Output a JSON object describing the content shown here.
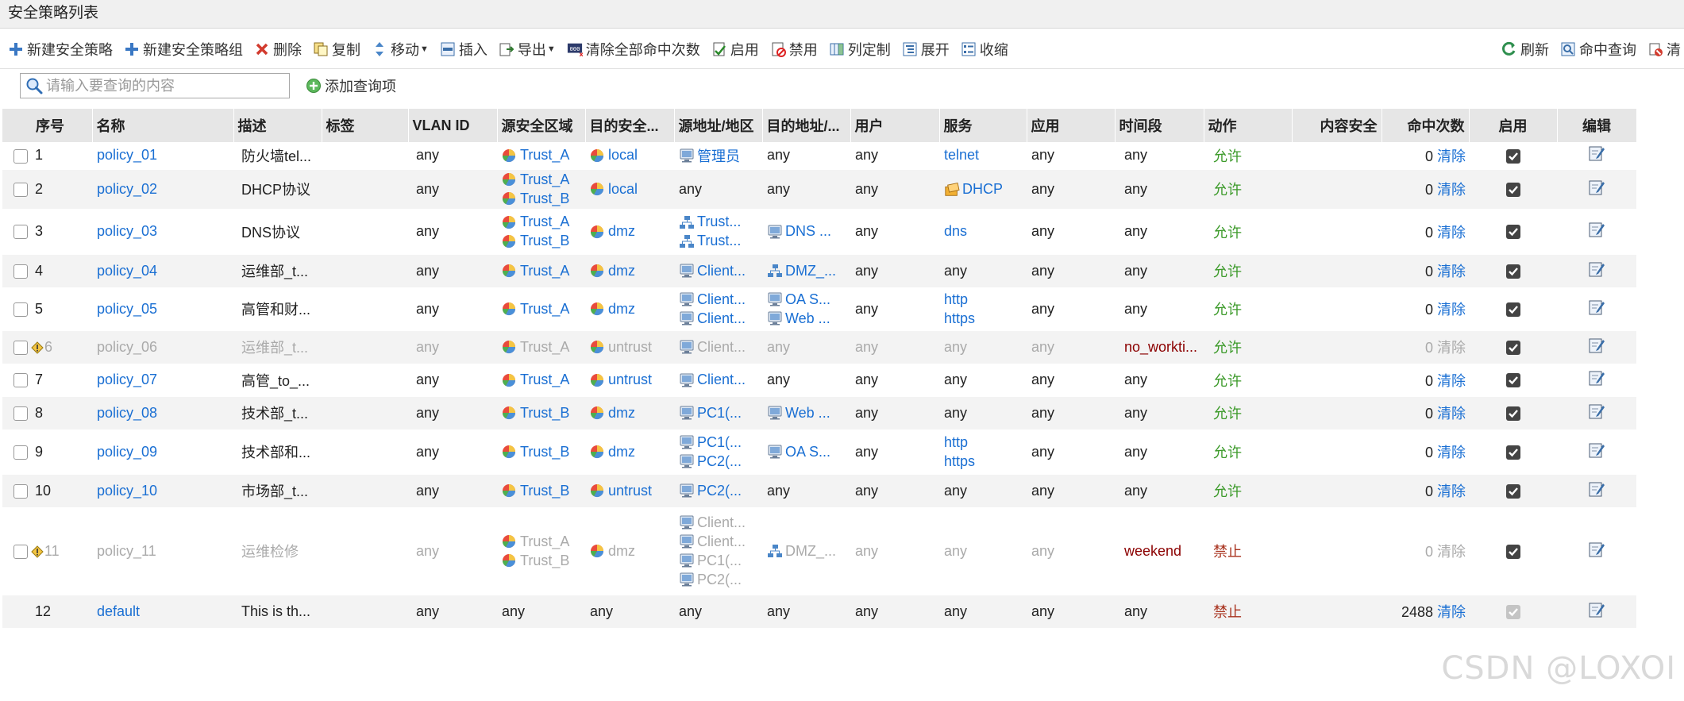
{
  "window": {
    "title": "安全策略列表"
  },
  "toolbar": {
    "left": [
      {
        "label": "新建安全策略",
        "icon": "plus-icon",
        "dropdown": false
      },
      {
        "label": "新建安全策略组",
        "icon": "plus-icon",
        "dropdown": false
      },
      {
        "label": "删除",
        "icon": "delete-icon",
        "dropdown": false
      },
      {
        "label": "复制",
        "icon": "copy-icon",
        "dropdown": false
      },
      {
        "label": "移动",
        "icon": "move-icon",
        "dropdown": true
      },
      {
        "label": "插入",
        "icon": "insert-icon",
        "dropdown": false
      },
      {
        "label": "导出",
        "icon": "export-icon",
        "dropdown": true
      },
      {
        "label": "清除全部命中次数",
        "icon": "clear-hits-icon",
        "dropdown": false
      },
      {
        "label": "启用",
        "icon": "enable-icon",
        "dropdown": false
      },
      {
        "label": "禁用",
        "icon": "disable-icon",
        "dropdown": false
      },
      {
        "label": "列定制",
        "icon": "columns-icon",
        "dropdown": false
      },
      {
        "label": "展开",
        "icon": "expand-icon",
        "dropdown": false
      },
      {
        "label": "收缩",
        "icon": "collapse-icon",
        "dropdown": false
      }
    ],
    "right": [
      {
        "label": "刷新",
        "icon": "refresh-icon"
      },
      {
        "label": "命中查询",
        "icon": "hit-query-icon"
      },
      {
        "label": "清",
        "icon": "clear-icon"
      }
    ]
  },
  "search": {
    "placeholder": "请输入要查询的内容",
    "add_query_label": "添加查询项"
  },
  "columns": [
    "序号",
    "名称",
    "描述",
    "标签",
    "VLAN ID",
    "源安全区域",
    "目的安全...",
    "源地址/地区",
    "目的地址/...",
    "用户",
    "服务",
    "应用",
    "时间段",
    "动作",
    "内容安全",
    "命中次数",
    "启用",
    "编辑"
  ],
  "rows": [
    {
      "id": "1",
      "name": "policy_01",
      "desc": "防火墙tel...",
      "tag": "",
      "vlan": "any",
      "src_zone": [
        {
          "text": "Trust_A",
          "icon": "zone-icon"
        }
      ],
      "dst_zone": [
        {
          "text": "local",
          "icon": "zone-icon"
        }
      ],
      "src_addr": [
        {
          "text": "管理员",
          "icon": "host-icon",
          "link": true
        }
      ],
      "dst_addr": [
        {
          "text": "any"
        }
      ],
      "user": "any",
      "service": [
        {
          "text": "telnet",
          "link": true
        }
      ],
      "app": "any",
      "time": "any",
      "time_red": false,
      "action": "允许",
      "action_type": "allow",
      "hits": "0",
      "clear": "清除",
      "enabled": true,
      "disabled_row": false,
      "warn": false,
      "height": 34
    },
    {
      "id": "2",
      "name": "policy_02",
      "desc": "DHCP协议",
      "tag": "",
      "vlan": "any",
      "src_zone": [
        {
          "text": "Trust_A",
          "icon": "zone-icon"
        },
        {
          "text": "Trust_B",
          "icon": "zone-icon"
        }
      ],
      "dst_zone": [
        {
          "text": "local",
          "icon": "zone-icon"
        }
      ],
      "src_addr": [
        {
          "text": "any"
        }
      ],
      "dst_addr": [
        {
          "text": "any"
        }
      ],
      "user": "any",
      "service": [
        {
          "text": "DHCP",
          "icon": "service-icon",
          "link": true
        }
      ],
      "app": "any",
      "time": "any",
      "time_red": false,
      "action": "允许",
      "action_type": "allow",
      "hits": "0",
      "clear": "清除",
      "enabled": true,
      "disabled_row": false,
      "warn": false,
      "height": 48
    },
    {
      "id": "3",
      "name": "policy_03",
      "desc": "DNS协议",
      "tag": "",
      "vlan": "any",
      "src_zone": [
        {
          "text": "Trust_A",
          "icon": "zone-icon"
        },
        {
          "text": "Trust_B",
          "icon": "zone-icon"
        }
      ],
      "dst_zone": [
        {
          "text": "dmz",
          "icon": "zone-icon"
        }
      ],
      "src_addr": [
        {
          "text": "Trust...",
          "icon": "network-icon",
          "link": true
        },
        {
          "text": "Trust...",
          "icon": "network-icon",
          "link": true
        }
      ],
      "dst_addr": [
        {
          "text": "DNS ...",
          "icon": "host-icon",
          "link": true
        }
      ],
      "user": "any",
      "service": [
        {
          "text": "dns",
          "link": true
        }
      ],
      "app": "any",
      "time": "any",
      "time_red": false,
      "action": "允许",
      "action_type": "allow",
      "hits": "0",
      "clear": "清除",
      "enabled": true,
      "disabled_row": false,
      "warn": false,
      "height": 57
    },
    {
      "id": "4",
      "name": "policy_04",
      "desc": "运维部_t...",
      "tag": "",
      "vlan": "any",
      "src_zone": [
        {
          "text": "Trust_A",
          "icon": "zone-icon"
        }
      ],
      "dst_zone": [
        {
          "text": "dmz",
          "icon": "zone-icon"
        }
      ],
      "src_addr": [
        {
          "text": "Client...",
          "icon": "host-icon",
          "link": true
        }
      ],
      "dst_addr": [
        {
          "text": "DMZ_...",
          "icon": "network-icon",
          "link": true
        }
      ],
      "user": "any",
      "service": [
        {
          "text": "any"
        }
      ],
      "app": "any",
      "time": "any",
      "time_red": false,
      "action": "允许",
      "action_type": "allow",
      "hits": "0",
      "clear": "清除",
      "enabled": true,
      "disabled_row": false,
      "warn": false,
      "height": 42
    },
    {
      "id": "5",
      "name": "policy_05",
      "desc": "高管和财...",
      "tag": "",
      "vlan": "any",
      "src_zone": [
        {
          "text": "Trust_A",
          "icon": "zone-icon"
        }
      ],
      "dst_zone": [
        {
          "text": "dmz",
          "icon": "zone-icon"
        }
      ],
      "src_addr": [
        {
          "text": "Client...",
          "icon": "host-icon",
          "link": true
        },
        {
          "text": "Client...",
          "icon": "host-icon",
          "link": true
        }
      ],
      "dst_addr": [
        {
          "text": "OA S...",
          "icon": "host-icon",
          "link": true
        },
        {
          "text": "Web ...",
          "icon": "host-icon",
          "link": true
        }
      ],
      "user": "any",
      "service": [
        {
          "text": "http",
          "link": true
        },
        {
          "text": "https",
          "link": true
        }
      ],
      "app": "any",
      "time": "any",
      "time_red": false,
      "action": "允许",
      "action_type": "allow",
      "hits": "0",
      "clear": "清除",
      "enabled": true,
      "disabled_row": false,
      "warn": false,
      "height": 54
    },
    {
      "id": "6",
      "name": "policy_06",
      "desc": "运维部_t...",
      "tag": "",
      "vlan": "any",
      "src_zone": [
        {
          "text": "Trust_A",
          "icon": "zone-icon"
        }
      ],
      "dst_zone": [
        {
          "text": "untrust",
          "icon": "zone-icon"
        }
      ],
      "src_addr": [
        {
          "text": "Client...",
          "icon": "host-icon",
          "link": true
        }
      ],
      "dst_addr": [
        {
          "text": "any"
        }
      ],
      "user": "any",
      "service": [
        {
          "text": "any"
        }
      ],
      "app": "any",
      "time": "no_workti...",
      "time_red": true,
      "action": "允许",
      "action_type": "allow",
      "hits": "0",
      "clear": "清除",
      "enabled": true,
      "disabled_row": true,
      "warn": true,
      "height": 42
    },
    {
      "id": "7",
      "name": "policy_07",
      "desc": "高管_to_...",
      "tag": "",
      "vlan": "any",
      "src_zone": [
        {
          "text": "Trust_A",
          "icon": "zone-icon"
        }
      ],
      "dst_zone": [
        {
          "text": "untrust",
          "icon": "zone-icon"
        }
      ],
      "src_addr": [
        {
          "text": "Client...",
          "icon": "host-icon",
          "link": true
        }
      ],
      "dst_addr": [
        {
          "text": "any"
        }
      ],
      "user": "any",
      "service": [
        {
          "text": "any"
        }
      ],
      "app": "any",
      "time": "any",
      "time_red": false,
      "action": "允许",
      "action_type": "allow",
      "hits": "0",
      "clear": "清除",
      "enabled": true,
      "disabled_row": false,
      "warn": false,
      "height": 41
    },
    {
      "id": "8",
      "name": "policy_08",
      "desc": "技术部_t...",
      "tag": "",
      "vlan": "any",
      "src_zone": [
        {
          "text": "Trust_B",
          "icon": "zone-icon"
        }
      ],
      "dst_zone": [
        {
          "text": "dmz",
          "icon": "zone-icon"
        }
      ],
      "src_addr": [
        {
          "text": "PC1(...",
          "icon": "host-icon",
          "link": true
        }
      ],
      "dst_addr": [
        {
          "text": "Web ...",
          "icon": "host-icon",
          "link": true
        }
      ],
      "user": "any",
      "service": [
        {
          "text": "any"
        }
      ],
      "app": "any",
      "time": "any",
      "time_red": false,
      "action": "允许",
      "action_type": "allow",
      "hits": "0",
      "clear": "清除",
      "enabled": true,
      "disabled_row": false,
      "warn": false,
      "height": 42
    },
    {
      "id": "9",
      "name": "policy_09",
      "desc": "技术部和...",
      "tag": "",
      "vlan": "any",
      "src_zone": [
        {
          "text": "Trust_B",
          "icon": "zone-icon"
        }
      ],
      "dst_zone": [
        {
          "text": "dmz",
          "icon": "zone-icon"
        }
      ],
      "src_addr": [
        {
          "text": "PC1(...",
          "icon": "host-icon",
          "link": true
        },
        {
          "text": "PC2(...",
          "icon": "host-icon",
          "link": true
        }
      ],
      "dst_addr": [
        {
          "text": "OA S...",
          "icon": "host-icon",
          "link": true
        }
      ],
      "user": "any",
      "service": [
        {
          "text": "http",
          "link": true
        },
        {
          "text": "https",
          "link": true
        }
      ],
      "app": "any",
      "time": "any",
      "time_red": false,
      "action": "允许",
      "action_type": "allow",
      "hits": "0",
      "clear": "清除",
      "enabled": true,
      "disabled_row": false,
      "warn": false,
      "height": 56
    },
    {
      "id": "10",
      "name": "policy_10",
      "desc": "市场部_t...",
      "tag": "",
      "vlan": "any",
      "src_zone": [
        {
          "text": "Trust_B",
          "icon": "zone-icon"
        }
      ],
      "dst_zone": [
        {
          "text": "untrust",
          "icon": "zone-icon"
        }
      ],
      "src_addr": [
        {
          "text": "PC2(...",
          "icon": "host-icon",
          "link": true
        }
      ],
      "dst_addr": [
        {
          "text": "any"
        }
      ],
      "user": "any",
      "service": [
        {
          "text": "any"
        }
      ],
      "app": "any",
      "time": "any",
      "time_red": false,
      "action": "允许",
      "action_type": "allow",
      "hits": "0",
      "clear": "清除",
      "enabled": true,
      "disabled_row": false,
      "warn": false,
      "height": 42
    },
    {
      "id": "11",
      "name": "policy_11",
      "desc": "运维检修",
      "tag": "",
      "vlan": "any",
      "src_zone": [
        {
          "text": "Trust_A",
          "icon": "zone-icon"
        },
        {
          "text": "Trust_B",
          "icon": "zone-icon"
        }
      ],
      "dst_zone": [
        {
          "text": "dmz",
          "icon": "zone-icon"
        }
      ],
      "src_addr": [
        {
          "text": "Client...",
          "icon": "host-icon",
          "link": true
        },
        {
          "text": "Client...",
          "icon": "host-icon",
          "link": true
        },
        {
          "text": "PC1(...",
          "icon": "host-icon",
          "link": true
        },
        {
          "text": "PC2(...",
          "icon": "host-icon",
          "link": true
        }
      ],
      "dst_addr": [
        {
          "text": "DMZ_...",
          "icon": "network-icon",
          "link": true
        }
      ],
      "user": "any",
      "service": [
        {
          "text": "any"
        }
      ],
      "app": "any",
      "time": "weekend",
      "time_red": true,
      "action": "禁止",
      "action_type": "deny",
      "hits": "0",
      "clear": "清除",
      "enabled": true,
      "disabled_row": true,
      "warn": true,
      "height": 110
    },
    {
      "id": "12",
      "name": "default",
      "desc": "This is th...",
      "tag": "",
      "vlan": "any",
      "src_zone": [
        {
          "text": "any"
        }
      ],
      "dst_zone": [
        {
          "text": "any"
        }
      ],
      "src_addr": [
        {
          "text": "any"
        }
      ],
      "dst_addr": [
        {
          "text": "any"
        }
      ],
      "user": "any",
      "service": [
        {
          "text": "any"
        }
      ],
      "app": "any",
      "time": "any",
      "time_red": false,
      "action": "禁止",
      "action_type": "deny",
      "hits": "2488",
      "clear": "清除",
      "enabled": true,
      "enabled_grey": true,
      "no_checkbox": true,
      "disabled_row": false,
      "warn": false,
      "height": 42
    }
  ],
  "watermark": "CSDN @LOXOI",
  "colors": {
    "link": "#1a6fd3",
    "allow": "#3c9a2a",
    "deny": "#a8321e",
    "header_bg": "#e6e6e6",
    "stripe_bg": "#f3f3f3"
  }
}
